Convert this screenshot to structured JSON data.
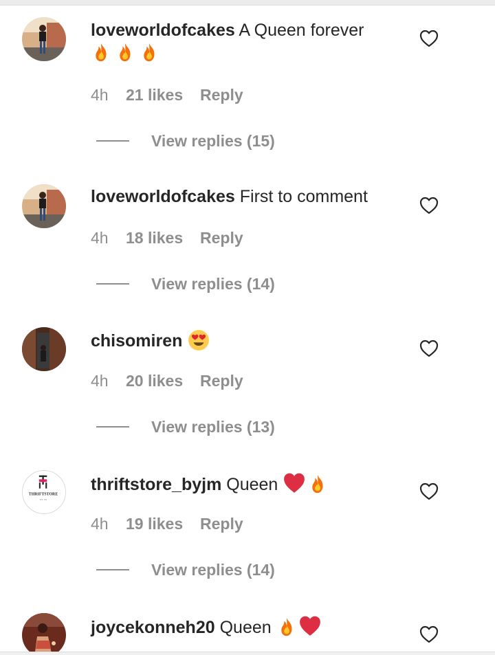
{
  "comments": [
    {
      "username": "loveworldofcakes",
      "text": "A Queen forever",
      "emoji_line": [
        "fire-icon",
        "fire-icon",
        "fire-icon"
      ],
      "time": "4h",
      "likes": "21 likes",
      "reply": "Reply",
      "view_replies": "View replies (15)"
    },
    {
      "username": "loveworldofcakes",
      "text": "First to comment",
      "time": "4h",
      "likes": "18 likes",
      "reply": "Reply",
      "view_replies": "View replies (14)"
    },
    {
      "username": "chisomiren",
      "text": "",
      "inline_emoji": [
        "heart-eyes-emoji"
      ],
      "time": "4h",
      "likes": "20 likes",
      "reply": "Reply",
      "view_replies": "View replies (13)"
    },
    {
      "username": "thriftstore_byjm",
      "text": "Queen",
      "inline_emoji": [
        "red-heart-emoji",
        "fire-icon"
      ],
      "avatar_logo_text": "THRIFTSTORE",
      "avatar_logo_subtext": "BY JM",
      "time": "4h",
      "likes": "19 likes",
      "reply": "Reply",
      "view_replies": "View replies (14)"
    },
    {
      "username": "joycekonneh20",
      "text": "Queen",
      "inline_emoji": [
        "fire-icon",
        "red-heart-emoji"
      ]
    }
  ],
  "colors": {
    "text": "#262626",
    "secondary": "#8e8e8e",
    "divider": "#dbdbdb",
    "logo_accent": "#e0245e"
  }
}
